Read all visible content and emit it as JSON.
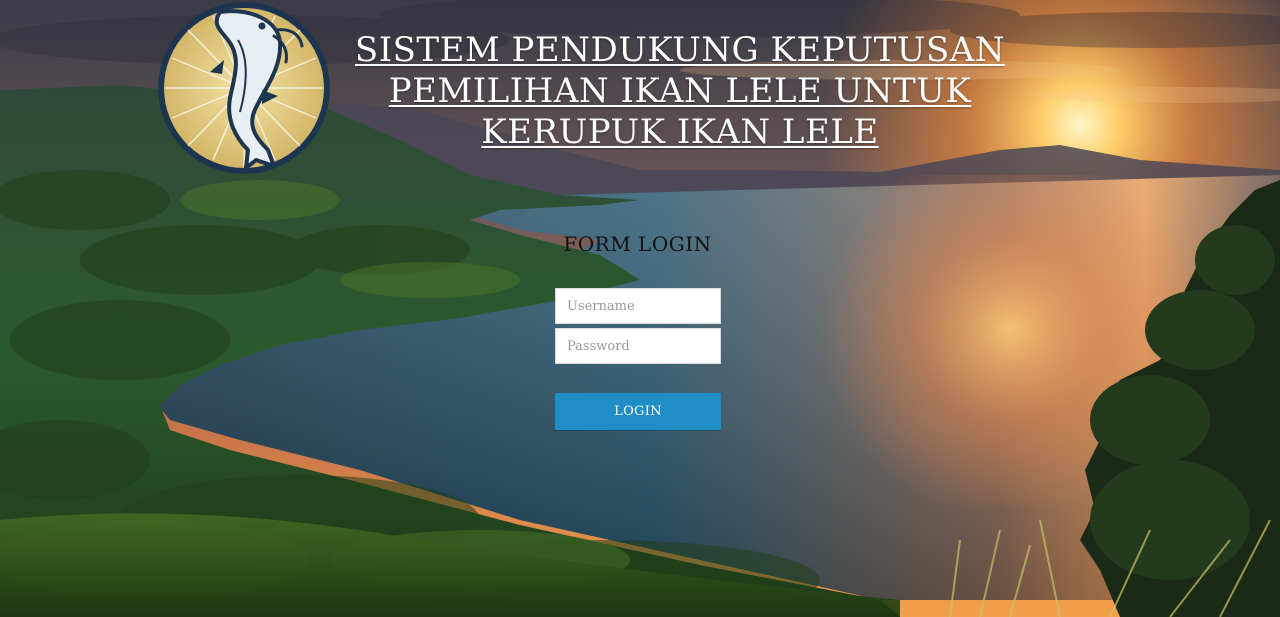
{
  "header": {
    "title_lines": [
      "SISTEM PENDUKUNG KEPUTUSAN",
      "PEMILIHAN IKAN LELE UNTUK",
      "KERUPUK IKAN LELE"
    ],
    "logo_icon": "catfish-logo-icon"
  },
  "login_form": {
    "heading": "FORM LOGIN",
    "username_placeholder": "Username",
    "password_placeholder": "Password",
    "submit_label": "LOGIN"
  },
  "colors": {
    "button": "#1f8dc6",
    "title_text": "#ffffff",
    "form_heading": "#111111"
  }
}
